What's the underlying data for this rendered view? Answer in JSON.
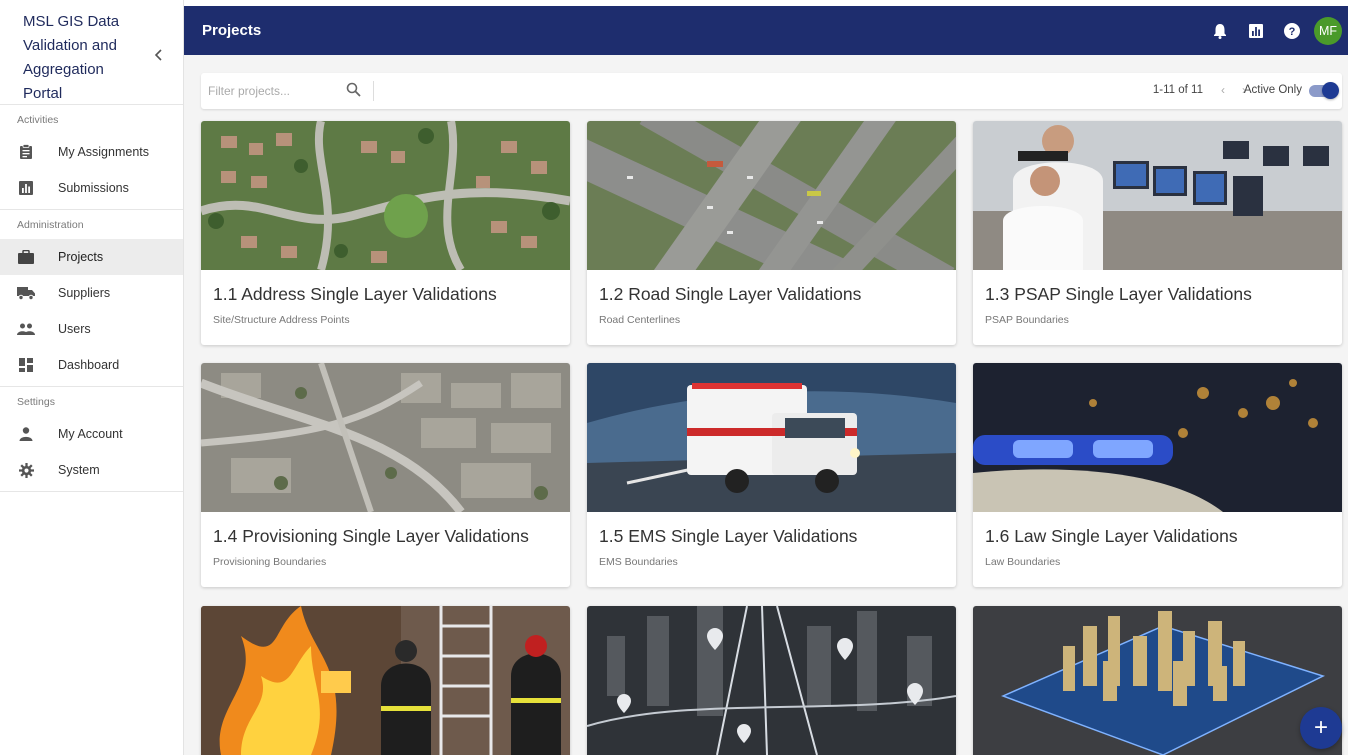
{
  "sidebar": {
    "title": "MSL GIS Data Validation and Aggregation Portal",
    "collapse_icon": "chevron-left-icon",
    "sections": [
      {
        "label": "Activities",
        "items": [
          {
            "label": "My Assignments",
            "icon": "assignment-icon"
          },
          {
            "label": "Submissions",
            "icon": "bar-chart-icon"
          }
        ]
      },
      {
        "label": "Administration",
        "items": [
          {
            "label": "Projects",
            "icon": "briefcase-icon",
            "active": true
          },
          {
            "label": "Suppliers",
            "icon": "truck-icon"
          },
          {
            "label": "Users",
            "icon": "people-icon"
          },
          {
            "label": "Dashboard",
            "icon": "dashboard-icon"
          }
        ]
      },
      {
        "label": "Settings",
        "items": [
          {
            "label": "My Account",
            "icon": "person-icon"
          },
          {
            "label": "System",
            "icon": "gear-icon"
          }
        ]
      }
    ]
  },
  "header": {
    "title": "Projects",
    "icons": [
      "bell-icon",
      "report-icon",
      "help-icon"
    ],
    "avatar": "MF",
    "color": "#1e2d6e"
  },
  "filter": {
    "placeholder": "Filter projects...",
    "value": "",
    "pagination": "1-11 of 11",
    "prev": "‹",
    "next": "›",
    "active_only_label": "Active Only",
    "active_only": true
  },
  "projects": [
    {
      "title": "1.1 Address Single Layer Validations",
      "subtitle": "Site/Structure Address Points",
      "image": "aerial-neighborhood"
    },
    {
      "title": "1.2 Road Single Layer Validations",
      "subtitle": "Road Centerlines",
      "image": "highway-interchange"
    },
    {
      "title": "1.3 PSAP Single Layer Validations",
      "subtitle": "PSAP Boundaries",
      "image": "dispatch-center"
    },
    {
      "title": "1.4 Provisioning Single Layer Validations",
      "subtitle": "Provisioning Boundaries",
      "image": "aerial-city"
    },
    {
      "title": "1.5 EMS Single Layer Validations",
      "subtitle": "EMS Boundaries",
      "image": "ambulance-tunnel"
    },
    {
      "title": "1.6 Law Single Layer Validations",
      "subtitle": "Law Boundaries",
      "image": "police-lights"
    },
    {
      "title": "",
      "subtitle": "",
      "image": "firefighters"
    },
    {
      "title": "",
      "subtitle": "",
      "image": "city-map-pins"
    },
    {
      "title": "",
      "subtitle": "",
      "image": "3d-city-model"
    }
  ],
  "fab": {
    "label": "+",
    "icon": "add-icon"
  },
  "colors": {
    "accent": "#1e3a93",
    "avatar": "#4a9a2a"
  }
}
